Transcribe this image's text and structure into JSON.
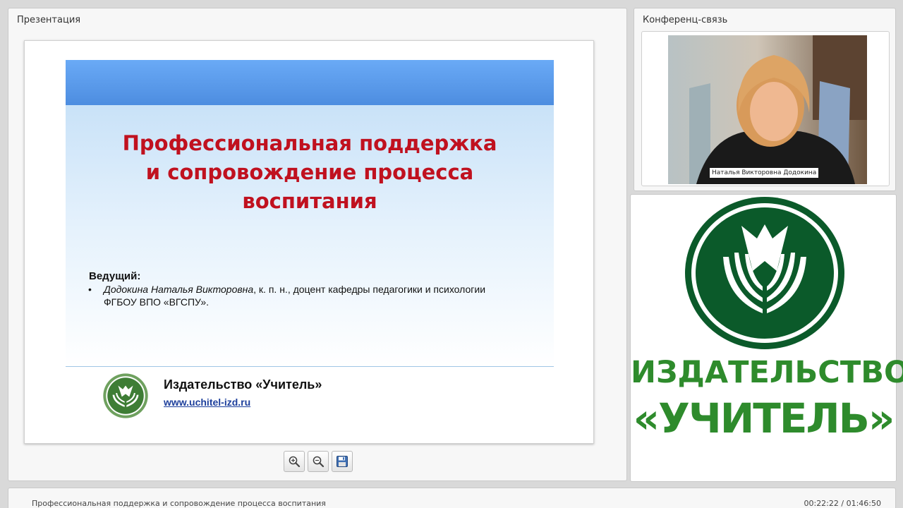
{
  "presentation_panel": {
    "title": "Презентация"
  },
  "slide": {
    "title": "Профессиональная поддержка\nи сопровождение процесса\nвоспитания",
    "host_heading": "Ведущий:",
    "host_bullet": "•",
    "host_name": "Додокина Наталья Викторовна",
    "host_details": ", к. п. н., доцент кафедры педагогики и психологии",
    "host_org": "ФГБОУ ВПО «ВГСПУ».",
    "footer_publisher": "Издательство «Учитель»",
    "footer_url": "www.uchitel-izd.ru"
  },
  "toolbar": {
    "zoom_in_icon": "zoom-in-icon",
    "zoom_out_icon": "zoom-out-icon",
    "save_icon": "floppy-disk-icon"
  },
  "conference_panel": {
    "title": "Конференц-связь",
    "participant_name": "Наталья Викторовна Додокина"
  },
  "logo_panel": {
    "label": "ИЗДАТЕЛЬСТВО",
    "name": "«УЧИТЕЛЬ»"
  },
  "status_bar": {
    "title": "Профессиональная поддержка и сопровождение процесса воспитания",
    "time": "00:22:22 / 01:46:50"
  },
  "colors": {
    "slide_title": "#c0111f",
    "brand_green": "#2e8b2c",
    "logo_dark_green": "#0b5a2a",
    "slide_header_blue": "#5b9aec",
    "link_blue": "#1d3f9c"
  }
}
